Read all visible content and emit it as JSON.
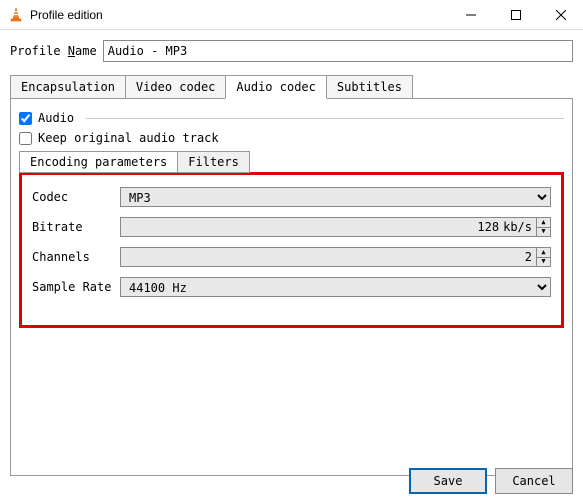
{
  "window": {
    "title": "Profile edition"
  },
  "profile": {
    "name_label_pre": "Profile ",
    "name_label_u": "N",
    "name_label_post": "ame",
    "name_value": "Audio - MP3"
  },
  "tabs": {
    "encapsulation": "Encapsulation",
    "video": "Video codec",
    "audio": "Audio codec",
    "subtitles": "Subtitles"
  },
  "audio": {
    "audio_checkbox": "Audio",
    "keep_original": "Keep original audio track",
    "audio_checked": true,
    "keep_checked": false
  },
  "subtabs": {
    "encoding": "Encoding parameters",
    "filters": "Filters"
  },
  "fields": {
    "codec_label": "Codec",
    "codec_value": "MP3",
    "bitrate_label": "Bitrate",
    "bitrate_value": "128",
    "bitrate_unit": "kb/s",
    "channels_label": "Channels",
    "channels_value": "2",
    "samplerate_label": "Sample Rate",
    "samplerate_value": "44100 Hz"
  },
  "buttons": {
    "save": "Save",
    "cancel": "Cancel"
  }
}
